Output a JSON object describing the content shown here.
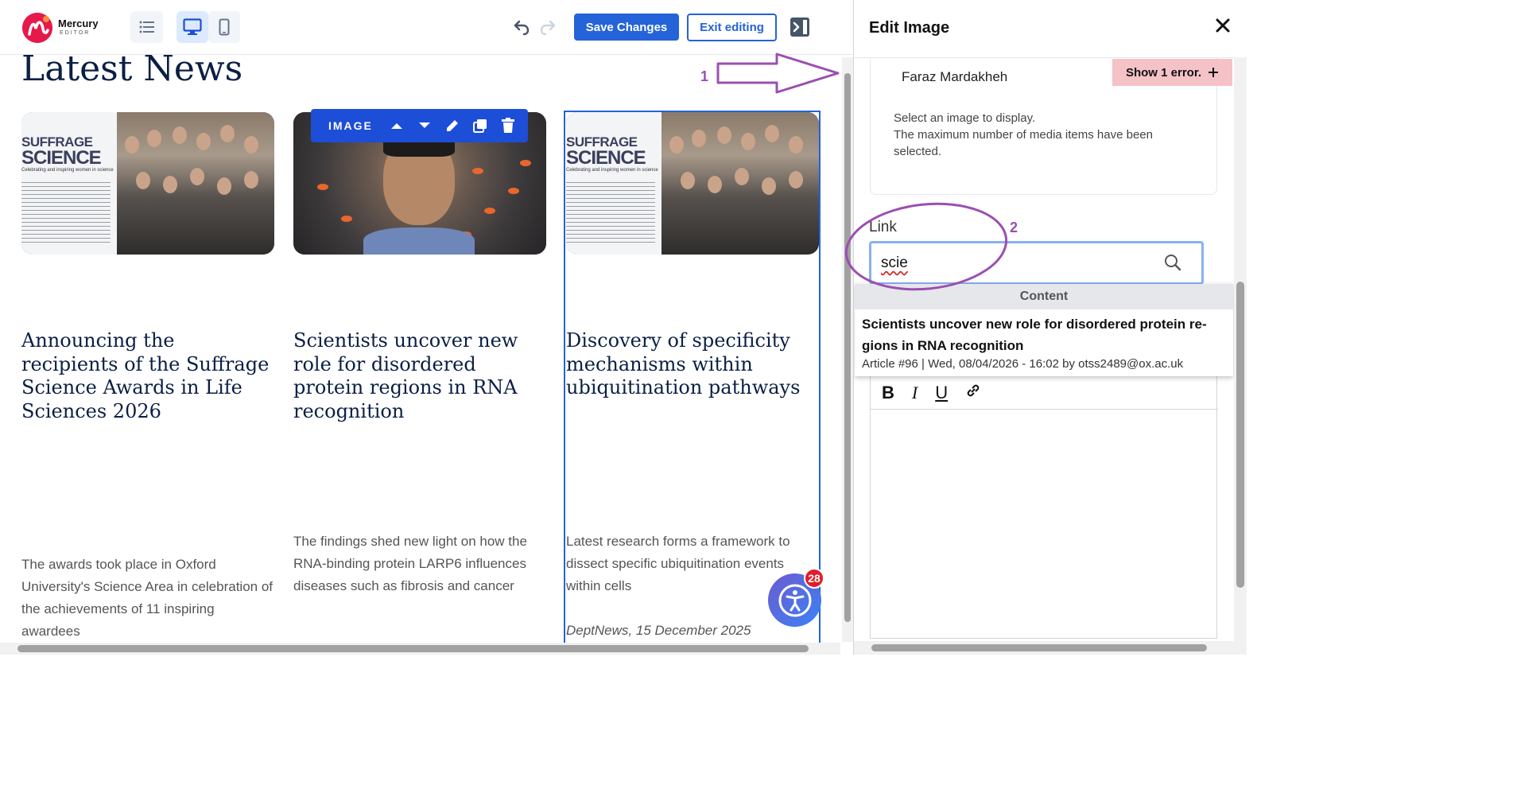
{
  "toolbar": {
    "logo_name": "Mercury",
    "logo_sub": "EDITOR",
    "save_label": "Save Changes",
    "exit_label": "Exit editing"
  },
  "page": {
    "title": "Latest News"
  },
  "image_toolbar": {
    "label": "IMAGE"
  },
  "cards": [
    {
      "banner_line1": "SUFFRAGE",
      "banner_line2": "SCIENCE",
      "banner_tagline": "Celebrating and inspiring women in science",
      "title": "Announcing the recipients of the Suffrage Science Awards in Life Sciences 2026",
      "description": "The awards took place in Oxford University's Science Area in celebration of the achievements of 11 inspiring awardees",
      "meta": ""
    },
    {
      "title": "Scientists uncover new role for disordered protein regions in RNA recognition",
      "description": "The findings shed new light on how the RNA-binding protein LARP6 influences diseases such as fibrosis and cancer",
      "meta": ""
    },
    {
      "banner_line1": "SUFFRAGE",
      "banner_line2": "SCIENCE",
      "banner_tagline": "Celebrating and inspiring women in science",
      "title": "Discovery of specificity mechanisms within ubiquitination pathways",
      "description": "Latest research forms a framework to dissect specific ubiquitination events within cells",
      "meta": "DeptNews, 15 December 2025"
    }
  ],
  "accessibility": {
    "badge_count": "28"
  },
  "annotations": {
    "marker_1": "1",
    "marker_2": "2",
    "color": "#9b4fb0"
  },
  "panel": {
    "title": "Edit Image",
    "media_author": "Faraz Mardakheh",
    "error_button": "Show 1 error.",
    "help_line1": "Select an image to display.",
    "help_line2": "The maximum number of media items have been selected.",
    "link_label": "Link",
    "link_value": "scie",
    "dropdown": {
      "header": "Content",
      "result_title": "Scientists uncover new role for disordered protein re-gions in RNA recognition",
      "result_meta": "Article #96 | Wed, 08/04/2026 - 16:02 by otss2489@ox.ac.uk"
    },
    "editor_buttons": [
      "B",
      "I",
      "U"
    ]
  },
  "colors": {
    "primary": "#2563d8",
    "heading": "#0b1f44",
    "error_bg": "#f5c2c7",
    "annotation": "#9b4fb0"
  }
}
